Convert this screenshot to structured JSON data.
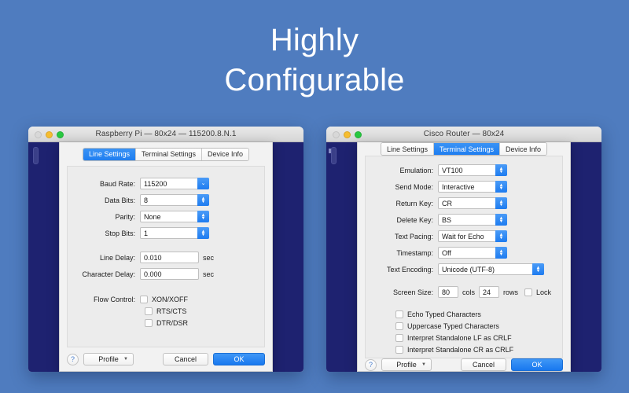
{
  "headline": {
    "line1": "Highly",
    "line2": "Configurable"
  },
  "colors": {
    "background": "#4f7cbf",
    "terminal": "#1e2270",
    "accent": "#1e7cf0",
    "title_text": "#ffffff"
  },
  "windows": [
    {
      "id": "left",
      "title": "Raspberry Pi — 80x24 — 115200.8.N.1",
      "traffic_lights": [
        "close-disabled",
        "minimize",
        "zoom"
      ],
      "tabs": [
        {
          "label": "Line Settings",
          "active": true
        },
        {
          "label": "Terminal Settings",
          "active": false
        },
        {
          "label": "Device Info",
          "active": false
        }
      ],
      "fields": [
        {
          "label": "Baud Rate:",
          "value": "115200",
          "control": "popup"
        },
        {
          "label": "Data Bits:",
          "value": "8",
          "control": "stepper"
        },
        {
          "label": "Parity:",
          "value": "None",
          "control": "stepper"
        },
        {
          "label": "Stop Bits:",
          "value": "1",
          "control": "stepper"
        }
      ],
      "delays": [
        {
          "label": "Line Delay:",
          "value": "0.010",
          "unit": "sec"
        },
        {
          "label": "Character Delay:",
          "value": "0.000",
          "unit": "sec"
        }
      ],
      "flow_control": {
        "label": "Flow Control:",
        "options": [
          {
            "label": "XON/XOFF",
            "checked": false
          },
          {
            "label": "RTS/CTS",
            "checked": false
          },
          {
            "label": "DTR/DSR",
            "checked": false
          }
        ]
      },
      "buttons": {
        "help": "?",
        "profile": "Profile",
        "cancel": "Cancel",
        "ok": "OK"
      }
    },
    {
      "id": "right",
      "title": "Cisco Router — 80x24",
      "traffic_lights": [
        "close-disabled",
        "minimize",
        "zoom"
      ],
      "tabs": [
        {
          "label": "Line Settings",
          "active": false
        },
        {
          "label": "Terminal Settings",
          "active": true
        },
        {
          "label": "Device Info",
          "active": false
        }
      ],
      "fields": [
        {
          "label": "Emulation:",
          "value": "VT100",
          "control": "stepper"
        },
        {
          "label": "Send Mode:",
          "value": "Interactive",
          "control": "stepper"
        },
        {
          "label": "Return Key:",
          "value": "CR",
          "control": "stepper"
        },
        {
          "label": "Delete Key:",
          "value": "BS",
          "control": "stepper"
        },
        {
          "label": "Text Pacing:",
          "value": "Wait for Echo",
          "control": "stepper"
        },
        {
          "label": "Timestamp:",
          "value": "Off",
          "control": "stepper"
        }
      ],
      "encoding": {
        "label": "Text Encoding:",
        "value": "Unicode (UTF-8)",
        "control": "stepper"
      },
      "screen_size": {
        "label": "Screen Size:",
        "cols_value": "80",
        "cols_unit": "cols",
        "rows_value": "24",
        "rows_unit": "rows",
        "lock_label": "Lock",
        "lock_checked": false
      },
      "checkboxes": [
        {
          "label": "Echo Typed Characters",
          "checked": false
        },
        {
          "label": "Uppercase Typed Characters",
          "checked": false
        },
        {
          "label": "Interpret Standalone LF as CRLF",
          "checked": false
        },
        {
          "label": "Interpret Standalone CR as CRLF",
          "checked": false
        }
      ],
      "buttons": {
        "help": "?",
        "profile": "Profile",
        "cancel": "Cancel",
        "ok": "OK"
      }
    }
  ]
}
